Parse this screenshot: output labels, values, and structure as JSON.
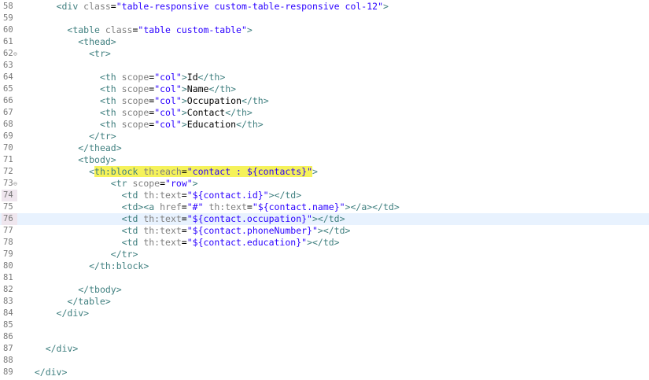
{
  "editor": {
    "highlight_color": "#f5f25a",
    "current_line": "76",
    "lines": [
      {
        "num": "58",
        "fold": "",
        "tokens": [
          {
            "t": "      "
          },
          {
            "t": "<div",
            "c": "tag"
          },
          {
            "t": " class",
            "c": "attr"
          },
          {
            "t": "=",
            "c": "txt"
          },
          {
            "t": "\"table-responsive custom-table-responsive col-12\"",
            "c": "val"
          },
          {
            "t": ">",
            "c": "tag"
          }
        ]
      },
      {
        "num": "59",
        "fold": "",
        "tokens": []
      },
      {
        "num": "60",
        "fold": "",
        "tokens": [
          {
            "t": "        "
          },
          {
            "t": "<table",
            "c": "tag"
          },
          {
            "t": " class",
            "c": "attr"
          },
          {
            "t": "=",
            "c": "txt"
          },
          {
            "t": "\"table custom-table\"",
            "c": "val"
          },
          {
            "t": ">",
            "c": "tag"
          }
        ]
      },
      {
        "num": "61",
        "fold": "",
        "tokens": [
          {
            "t": "          "
          },
          {
            "t": "<thead>",
            "c": "tag"
          }
        ]
      },
      {
        "num": "62",
        "fold": "⊖",
        "tokens": [
          {
            "t": "            "
          },
          {
            "t": "<tr>",
            "c": "tag"
          }
        ]
      },
      {
        "num": "63",
        "fold": "",
        "tokens": []
      },
      {
        "num": "64",
        "fold": "",
        "tokens": [
          {
            "t": "              "
          },
          {
            "t": "<th",
            "c": "tag"
          },
          {
            "t": " scope",
            "c": "attr"
          },
          {
            "t": "=",
            "c": "txt"
          },
          {
            "t": "\"col\"",
            "c": "val"
          },
          {
            "t": ">",
            "c": "tag"
          },
          {
            "t": "Id",
            "c": "txt"
          },
          {
            "t": "</th>",
            "c": "tag"
          }
        ]
      },
      {
        "num": "65",
        "fold": "",
        "tokens": [
          {
            "t": "              "
          },
          {
            "t": "<th",
            "c": "tag"
          },
          {
            "t": " scope",
            "c": "attr"
          },
          {
            "t": "=",
            "c": "txt"
          },
          {
            "t": "\"col\"",
            "c": "val"
          },
          {
            "t": ">",
            "c": "tag"
          },
          {
            "t": "Name",
            "c": "txt"
          },
          {
            "t": "</th>",
            "c": "tag"
          }
        ]
      },
      {
        "num": "66",
        "fold": "",
        "tokens": [
          {
            "t": "              "
          },
          {
            "t": "<th",
            "c": "tag"
          },
          {
            "t": " scope",
            "c": "attr"
          },
          {
            "t": "=",
            "c": "txt"
          },
          {
            "t": "\"col\"",
            "c": "val"
          },
          {
            "t": ">",
            "c": "tag"
          },
          {
            "t": "Occupation",
            "c": "txt"
          },
          {
            "t": "</th>",
            "c": "tag"
          }
        ]
      },
      {
        "num": "67",
        "fold": "",
        "tokens": [
          {
            "t": "              "
          },
          {
            "t": "<th",
            "c": "tag"
          },
          {
            "t": " scope",
            "c": "attr"
          },
          {
            "t": "=",
            "c": "txt"
          },
          {
            "t": "\"col\"",
            "c": "val"
          },
          {
            "t": ">",
            "c": "tag"
          },
          {
            "t": "Contact",
            "c": "txt"
          },
          {
            "t": "</th>",
            "c": "tag"
          }
        ]
      },
      {
        "num": "68",
        "fold": "",
        "tokens": [
          {
            "t": "              "
          },
          {
            "t": "<th",
            "c": "tag"
          },
          {
            "t": " scope",
            "c": "attr"
          },
          {
            "t": "=",
            "c": "txt"
          },
          {
            "t": "\"col\"",
            "c": "val"
          },
          {
            "t": ">",
            "c": "tag"
          },
          {
            "t": "Education",
            "c": "txt"
          },
          {
            "t": "</th>",
            "c": "tag"
          }
        ]
      },
      {
        "num": "69",
        "fold": "",
        "tokens": [
          {
            "t": "            "
          },
          {
            "t": "</tr>",
            "c": "tag"
          }
        ]
      },
      {
        "num": "70",
        "fold": "",
        "tokens": [
          {
            "t": "          "
          },
          {
            "t": "</thead>",
            "c": "tag"
          }
        ]
      },
      {
        "num": "71",
        "fold": "",
        "tokens": [
          {
            "t": "          "
          },
          {
            "t": "<tbody>",
            "c": "tag"
          }
        ]
      },
      {
        "num": "72",
        "fold": "",
        "tokens": [
          {
            "t": "            "
          },
          {
            "t": "<",
            "c": "tag"
          },
          {
            "t": "th:block",
            "c": "tag",
            "hl": true
          },
          {
            "t": " th:each",
            "c": "attr",
            "hl": true
          },
          {
            "t": "=",
            "c": "txt",
            "hl": true
          },
          {
            "t": "\"contact : ${contacts}\"",
            "c": "val",
            "hl": true
          },
          {
            "t": ">",
            "c": "tag"
          }
        ]
      },
      {
        "num": "73",
        "fold": "⊖",
        "tokens": [
          {
            "t": "                "
          },
          {
            "t": "<tr",
            "c": "tag"
          },
          {
            "t": " scope",
            "c": "attr"
          },
          {
            "t": "=",
            "c": "txt"
          },
          {
            "t": "\"row\"",
            "c": "val"
          },
          {
            "t": ">",
            "c": "tag"
          }
        ]
      },
      {
        "num": "74",
        "fold": "",
        "mark": true,
        "tokens": [
          {
            "t": "                  "
          },
          {
            "t": "<td",
            "c": "tag"
          },
          {
            "t": " th:text",
            "c": "attr"
          },
          {
            "t": "=",
            "c": "txt"
          },
          {
            "t": "\"${contact.id}\"",
            "c": "val"
          },
          {
            "t": "></td>",
            "c": "tag"
          }
        ]
      },
      {
        "num": "75",
        "fold": "",
        "tokens": [
          {
            "t": "                  "
          },
          {
            "t": "<td><a",
            "c": "tag"
          },
          {
            "t": " href",
            "c": "attr"
          },
          {
            "t": "=",
            "c": "txt"
          },
          {
            "t": "\"#\"",
            "c": "val"
          },
          {
            "t": " th:text",
            "c": "attr"
          },
          {
            "t": "=",
            "c": "txt"
          },
          {
            "t": "\"${contact.name}\"",
            "c": "val"
          },
          {
            "t": "></a></td>",
            "c": "tag"
          }
        ]
      },
      {
        "num": "76",
        "fold": "",
        "current": true,
        "mark": true,
        "tokens": [
          {
            "t": "                  "
          },
          {
            "t": "<td",
            "c": "tag"
          },
          {
            "t": " th:text",
            "c": "attr"
          },
          {
            "t": "=",
            "c": "txt"
          },
          {
            "t": "\"${contact.occupation}\"",
            "c": "val"
          },
          {
            "t": "></td>",
            "c": "tag"
          }
        ]
      },
      {
        "num": "77",
        "fold": "",
        "tokens": [
          {
            "t": "                  "
          },
          {
            "t": "<td",
            "c": "tag"
          },
          {
            "t": " th:text",
            "c": "attr"
          },
          {
            "t": "=",
            "c": "txt"
          },
          {
            "t": "\"${contact.phoneNumber}\"",
            "c": "val"
          },
          {
            "t": "></td>",
            "c": "tag"
          }
        ]
      },
      {
        "num": "78",
        "fold": "",
        "tokens": [
          {
            "t": "                  "
          },
          {
            "t": "<td",
            "c": "tag"
          },
          {
            "t": " th:text",
            "c": "attr"
          },
          {
            "t": "=",
            "c": "txt"
          },
          {
            "t": "\"${contact.education}\"",
            "c": "val"
          },
          {
            "t": "></td>",
            "c": "tag"
          }
        ]
      },
      {
        "num": "79",
        "fold": "",
        "tokens": [
          {
            "t": "                "
          },
          {
            "t": "</tr>",
            "c": "tag"
          }
        ]
      },
      {
        "num": "80",
        "fold": "",
        "tokens": [
          {
            "t": "            "
          },
          {
            "t": "</th:block>",
            "c": "tag"
          }
        ]
      },
      {
        "num": "81",
        "fold": "",
        "tokens": []
      },
      {
        "num": "82",
        "fold": "",
        "tokens": [
          {
            "t": "          "
          },
          {
            "t": "</tbody>",
            "c": "tag"
          }
        ]
      },
      {
        "num": "83",
        "fold": "",
        "tokens": [
          {
            "t": "        "
          },
          {
            "t": "</table>",
            "c": "tag"
          }
        ]
      },
      {
        "num": "84",
        "fold": "",
        "tokens": [
          {
            "t": "      "
          },
          {
            "t": "</div>",
            "c": "tag"
          }
        ]
      },
      {
        "num": "85",
        "fold": "",
        "tokens": []
      },
      {
        "num": "86",
        "fold": "",
        "tokens": []
      },
      {
        "num": "87",
        "fold": "",
        "tokens": [
          {
            "t": "    "
          },
          {
            "t": "</div>",
            "c": "tag"
          }
        ]
      },
      {
        "num": "88",
        "fold": "",
        "tokens": []
      },
      {
        "num": "89",
        "fold": "",
        "tokens": [
          {
            "t": "  "
          },
          {
            "t": "</div>",
            "c": "tag"
          }
        ]
      }
    ]
  }
}
